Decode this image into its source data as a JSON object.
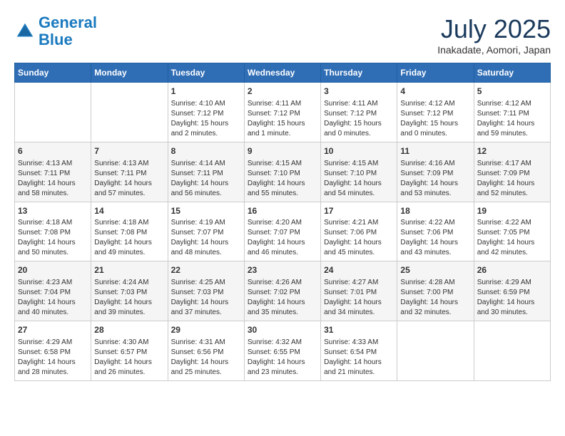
{
  "header": {
    "logo_line1": "General",
    "logo_line2": "Blue",
    "month": "July 2025",
    "location": "Inakadate, Aomori, Japan"
  },
  "weekdays": [
    "Sunday",
    "Monday",
    "Tuesday",
    "Wednesday",
    "Thursday",
    "Friday",
    "Saturday"
  ],
  "weeks": [
    [
      {
        "day": "",
        "info": ""
      },
      {
        "day": "",
        "info": ""
      },
      {
        "day": "1",
        "info": "Sunrise: 4:10 AM\nSunset: 7:12 PM\nDaylight: 15 hours\nand 2 minutes."
      },
      {
        "day": "2",
        "info": "Sunrise: 4:11 AM\nSunset: 7:12 PM\nDaylight: 15 hours\nand 1 minute."
      },
      {
        "day": "3",
        "info": "Sunrise: 4:11 AM\nSunset: 7:12 PM\nDaylight: 15 hours\nand 0 minutes."
      },
      {
        "day": "4",
        "info": "Sunrise: 4:12 AM\nSunset: 7:12 PM\nDaylight: 15 hours\nand 0 minutes."
      },
      {
        "day": "5",
        "info": "Sunrise: 4:12 AM\nSunset: 7:11 PM\nDaylight: 14 hours\nand 59 minutes."
      }
    ],
    [
      {
        "day": "6",
        "info": "Sunrise: 4:13 AM\nSunset: 7:11 PM\nDaylight: 14 hours\nand 58 minutes."
      },
      {
        "day": "7",
        "info": "Sunrise: 4:13 AM\nSunset: 7:11 PM\nDaylight: 14 hours\nand 57 minutes."
      },
      {
        "day": "8",
        "info": "Sunrise: 4:14 AM\nSunset: 7:11 PM\nDaylight: 14 hours\nand 56 minutes."
      },
      {
        "day": "9",
        "info": "Sunrise: 4:15 AM\nSunset: 7:10 PM\nDaylight: 14 hours\nand 55 minutes."
      },
      {
        "day": "10",
        "info": "Sunrise: 4:15 AM\nSunset: 7:10 PM\nDaylight: 14 hours\nand 54 minutes."
      },
      {
        "day": "11",
        "info": "Sunrise: 4:16 AM\nSunset: 7:09 PM\nDaylight: 14 hours\nand 53 minutes."
      },
      {
        "day": "12",
        "info": "Sunrise: 4:17 AM\nSunset: 7:09 PM\nDaylight: 14 hours\nand 52 minutes."
      }
    ],
    [
      {
        "day": "13",
        "info": "Sunrise: 4:18 AM\nSunset: 7:08 PM\nDaylight: 14 hours\nand 50 minutes."
      },
      {
        "day": "14",
        "info": "Sunrise: 4:18 AM\nSunset: 7:08 PM\nDaylight: 14 hours\nand 49 minutes."
      },
      {
        "day": "15",
        "info": "Sunrise: 4:19 AM\nSunset: 7:07 PM\nDaylight: 14 hours\nand 48 minutes."
      },
      {
        "day": "16",
        "info": "Sunrise: 4:20 AM\nSunset: 7:07 PM\nDaylight: 14 hours\nand 46 minutes."
      },
      {
        "day": "17",
        "info": "Sunrise: 4:21 AM\nSunset: 7:06 PM\nDaylight: 14 hours\nand 45 minutes."
      },
      {
        "day": "18",
        "info": "Sunrise: 4:22 AM\nSunset: 7:06 PM\nDaylight: 14 hours\nand 43 minutes."
      },
      {
        "day": "19",
        "info": "Sunrise: 4:22 AM\nSunset: 7:05 PM\nDaylight: 14 hours\nand 42 minutes."
      }
    ],
    [
      {
        "day": "20",
        "info": "Sunrise: 4:23 AM\nSunset: 7:04 PM\nDaylight: 14 hours\nand 40 minutes."
      },
      {
        "day": "21",
        "info": "Sunrise: 4:24 AM\nSunset: 7:03 PM\nDaylight: 14 hours\nand 39 minutes."
      },
      {
        "day": "22",
        "info": "Sunrise: 4:25 AM\nSunset: 7:03 PM\nDaylight: 14 hours\nand 37 minutes."
      },
      {
        "day": "23",
        "info": "Sunrise: 4:26 AM\nSunset: 7:02 PM\nDaylight: 14 hours\nand 35 minutes."
      },
      {
        "day": "24",
        "info": "Sunrise: 4:27 AM\nSunset: 7:01 PM\nDaylight: 14 hours\nand 34 minutes."
      },
      {
        "day": "25",
        "info": "Sunrise: 4:28 AM\nSunset: 7:00 PM\nDaylight: 14 hours\nand 32 minutes."
      },
      {
        "day": "26",
        "info": "Sunrise: 4:29 AM\nSunset: 6:59 PM\nDaylight: 14 hours\nand 30 minutes."
      }
    ],
    [
      {
        "day": "27",
        "info": "Sunrise: 4:29 AM\nSunset: 6:58 PM\nDaylight: 14 hours\nand 28 minutes."
      },
      {
        "day": "28",
        "info": "Sunrise: 4:30 AM\nSunset: 6:57 PM\nDaylight: 14 hours\nand 26 minutes."
      },
      {
        "day": "29",
        "info": "Sunrise: 4:31 AM\nSunset: 6:56 PM\nDaylight: 14 hours\nand 25 minutes."
      },
      {
        "day": "30",
        "info": "Sunrise: 4:32 AM\nSunset: 6:55 PM\nDaylight: 14 hours\nand 23 minutes."
      },
      {
        "day": "31",
        "info": "Sunrise: 4:33 AM\nSunset: 6:54 PM\nDaylight: 14 hours\nand 21 minutes."
      },
      {
        "day": "",
        "info": ""
      },
      {
        "day": "",
        "info": ""
      }
    ]
  ]
}
